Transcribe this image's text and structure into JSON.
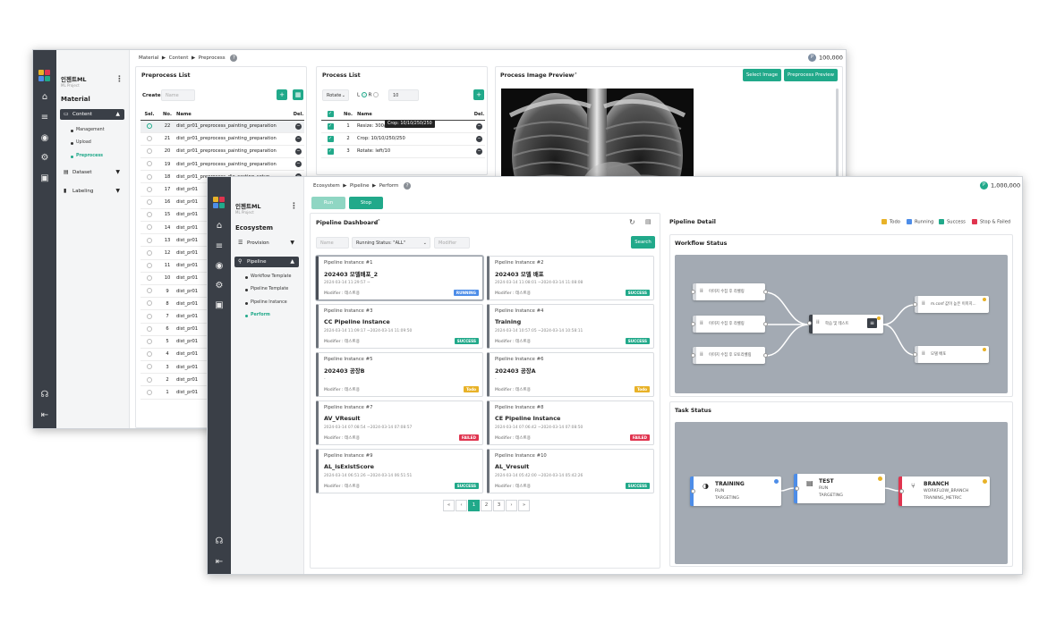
{
  "preprocess_window": {
    "brand": {
      "name": "인젠트ML",
      "sub": "ML Project"
    },
    "section": "Material",
    "menu": [
      {
        "label": "Content",
        "icon": "image-icon",
        "active": true
      },
      {
        "label": "Dataset",
        "icon": "dataset-icon"
      },
      {
        "label": "Labeling",
        "icon": "bookmark-icon"
      }
    ],
    "submenu": [
      "Management",
      "Upload",
      "Preprocess"
    ],
    "breadcrumb": [
      "Material",
      "Content",
      "Preprocess"
    ],
    "points": "100,000",
    "preprocess_list": {
      "title": "Preprocess List",
      "create_label": "Create",
      "name_placeholder": "Name",
      "headers": {
        "sel": "Sel.",
        "no": "No.",
        "name": "Name",
        "del": "Del."
      },
      "rows": [
        {
          "no": "22",
          "name": "dist_pr01_preprocess_painting_preparation"
        },
        {
          "no": "21",
          "name": "dist_pr01_preprocess_painting_preparation"
        },
        {
          "no": "20",
          "name": "dist_pr01_preprocess_painting_preparation"
        },
        {
          "no": "19",
          "name": "dist_pr01_preprocess_painting_preparation"
        },
        {
          "no": "18",
          "name": "dist_pr01_preprocess_die_casting_setup"
        },
        {
          "no": "17",
          "name": "dist_pr01"
        },
        {
          "no": "16",
          "name": "dist_pr01"
        },
        {
          "no": "15",
          "name": "dist_pr01"
        },
        {
          "no": "14",
          "name": "dist_pr01"
        },
        {
          "no": "13",
          "name": "dist_pr01"
        },
        {
          "no": "12",
          "name": "dist_pr01"
        },
        {
          "no": "11",
          "name": "dist_pr01"
        },
        {
          "no": "10",
          "name": "dist_pr01"
        },
        {
          "no": "9",
          "name": "dist_pr01"
        },
        {
          "no": "8",
          "name": "dist_pr01"
        },
        {
          "no": "7",
          "name": "dist_pr01"
        },
        {
          "no": "6",
          "name": "dist_pr01"
        },
        {
          "no": "5",
          "name": "dist_pr01"
        },
        {
          "no": "4",
          "name": "dist_pr01"
        },
        {
          "no": "3",
          "name": "dist_pr01"
        },
        {
          "no": "2",
          "name": "dist_pr01"
        },
        {
          "no": "1",
          "name": "dist_pr01"
        }
      ]
    },
    "process_list": {
      "title": "Process List",
      "operation": "Rotate",
      "l_label": "L",
      "r_label": "R",
      "value": "10",
      "headers": {
        "no": "No.",
        "name": "Name",
        "del": "Del."
      },
      "rows": [
        {
          "no": "1",
          "name": "Resize: 300/300"
        },
        {
          "no": "2",
          "name": "Crop: 10/10/250/250"
        },
        {
          "no": "3",
          "name": "Rotate: left/10"
        }
      ],
      "tooltip": "Crop: 10/10/250/250"
    },
    "preview": {
      "title": "Process Image Preview",
      "select_image_label": "Select Image",
      "preprocess_preview_label": "Preprocess Preview"
    }
  },
  "pipeline_window": {
    "brand": {
      "name": "인젠트ML",
      "sub": "ML Project"
    },
    "section": "Ecosystem",
    "menu": [
      {
        "label": "Provision",
        "icon": "server-icon"
      },
      {
        "label": "Pipeline",
        "icon": "pipeline-icon",
        "active": true
      }
    ],
    "submenu": [
      "Workflow Template",
      "Pipeline Template",
      "Pipeline Instance",
      "Perform"
    ],
    "breadcrumb": [
      "Ecosystem",
      "Pipeline",
      "Perform"
    ],
    "points": "1,000,000",
    "run_label": "Run",
    "stop_label": "Stop",
    "dashboard": {
      "title": "Pipeline Dashboard",
      "name_placeholder": "Name",
      "status_filter": "Running Status: \"ALL\"",
      "modifier_placeholder": "Modifier",
      "search_label": "Search",
      "instances": [
        {
          "header": "Pipeline Instance #1",
          "name": "202403 모델배포_2",
          "time": "2024-03-14 11:29:57 ~",
          "modifier": "Modifier : 테스트용",
          "status": "RUNNING",
          "cls": "b-run",
          "sel": true
        },
        {
          "header": "Pipeline Instance #2",
          "name": "202403 모델 배포",
          "time": "2024-03-14 11:08:01 ~2024-03-14 11:08:08",
          "modifier": "Modifier : 테스트용",
          "status": "SUCCESS",
          "cls": "b-suc"
        },
        {
          "header": "Pipeline Instance #3",
          "name": "CC Pipeline Instance",
          "time": "2024-03-14 11:09:17 ~2024-03-14 11:09:50",
          "modifier": "Modifier : 테스트용",
          "status": "SUCCESS",
          "cls": "b-suc"
        },
        {
          "header": "Pipeline Instance #4",
          "name": "Training",
          "time": "2024-03-14 10:57:05 ~2024-03-14 10:58:11",
          "modifier": "Modifier : 테스트용",
          "status": "SUCCESS",
          "cls": "b-suc"
        },
        {
          "header": "Pipeline Instance #5",
          "name": "202403 공장B",
          "time": "-",
          "modifier": "Modifier : 테스트용",
          "status": "Todo",
          "cls": "b-todo"
        },
        {
          "header": "Pipeline Instance #6",
          "name": "202403 공장A",
          "time": "-",
          "modifier": "Modifier : 테스트용",
          "status": "Todo",
          "cls": "b-todo"
        },
        {
          "header": "Pipeline Instance #7",
          "name": "AV_VResult",
          "time": "2024-03-14 07:08:54 ~2024-03-14 07:08:57",
          "modifier": "Modifier : 테스트용",
          "status": "FAILED",
          "cls": "b-fail"
        },
        {
          "header": "Pipeline Instance #8",
          "name": "CE Pipeline Instance",
          "time": "2024-03-14 07:06:42 ~2024-03-14 07:08:50",
          "modifier": "Modifier : 테스트용",
          "status": "FAILED",
          "cls": "b-fail"
        },
        {
          "header": "Pipeline Instance #9",
          "name": "AL_isExistScore",
          "time": "2024-03-14 06:51:26 ~2024-03-14 06:51:51",
          "modifier": "Modifier : 테스트용",
          "status": "SUCCESS",
          "cls": "b-suc"
        },
        {
          "header": "Pipeline Instance #10",
          "name": "AL_Vresult",
          "time": "2024-03-14 05:42:00 ~2024-03-14 05:42:26",
          "modifier": "Modifier : 테스트용",
          "status": "SUCCESS",
          "cls": "b-suc"
        }
      ],
      "pages": [
        "1",
        "2",
        "3"
      ]
    },
    "detail": {
      "title": "Pipeline Detail",
      "legend": [
        {
          "label": "Todo",
          "color": "#e8b228"
        },
        {
          "label": "Running",
          "color": "#4d8de8"
        },
        {
          "label": "Success",
          "color": "#21a98a"
        },
        {
          "label": "Stop & Failed",
          "color": "#e0344f"
        }
      ],
      "workflow_title": "Workflow Status",
      "workflow_nodes": [
        "이미지 수집 후 라벨링",
        "이미지 수집 후 라벨링",
        "이미지 수집 후 모토라벨링",
        "학습 및 테스트",
        "m.conf 값이 높은 이미지...",
        "모델 배포"
      ],
      "task_title": "Task Status",
      "tasks": [
        {
          "name": "TRAINING",
          "l1": "RUN",
          "l2": "TARGETING",
          "accent": "#4d8de8",
          "dot": "#4d8de8"
        },
        {
          "name": "TEST",
          "l1": "RUN",
          "l2": "TARGETING",
          "accent": "#4d8de8",
          "dot": "#e8b228"
        },
        {
          "name": "BRANCH",
          "l1": "WORKFLOW_BRANCH",
          "l2": "TRAINING_METRIC",
          "accent": "#e0344f",
          "dot": "#e8b228"
        }
      ]
    }
  }
}
